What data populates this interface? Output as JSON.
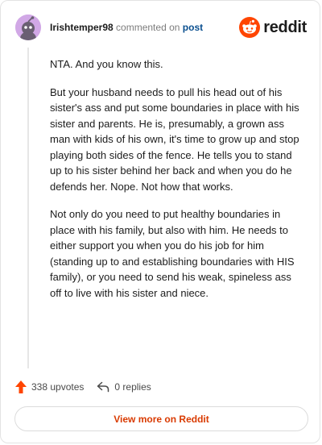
{
  "comment": {
    "username": "Irishtemper98",
    "commented_text": "commented on",
    "post_link": "post",
    "paragraphs": [
      "NTA. And you know this.",
      "But your husband needs to pull his head out of his sister's ass and put some boundaries in place with his sister and parents. He is, presumably, a grown ass man with kids of his own, it's time to grow up and stop playing both sides of the fence. He tells you to stand up to his sister behind her back and when you do he defends her. Nope. Not how that works.",
      "Not only do you need to put healthy boundaries in place with his family, but also with him. He needs to either support you when you do his job for him (standing up to and establishing boundaries with HIS family), or you need to send his weak, spineless ass off to live with his sister and niece."
    ],
    "upvotes": "338 upvotes",
    "replies": "0 replies"
  },
  "brand": {
    "wordmark": "reddit",
    "accent": "#ff4500"
  },
  "actions": {
    "view_more": "View more on Reddit"
  },
  "icons": {
    "avatar": "snoo-avatar-icon",
    "logo": "reddit-logo-icon",
    "upvote": "upvote-arrow-icon",
    "reply": "reply-arrow-icon"
  }
}
